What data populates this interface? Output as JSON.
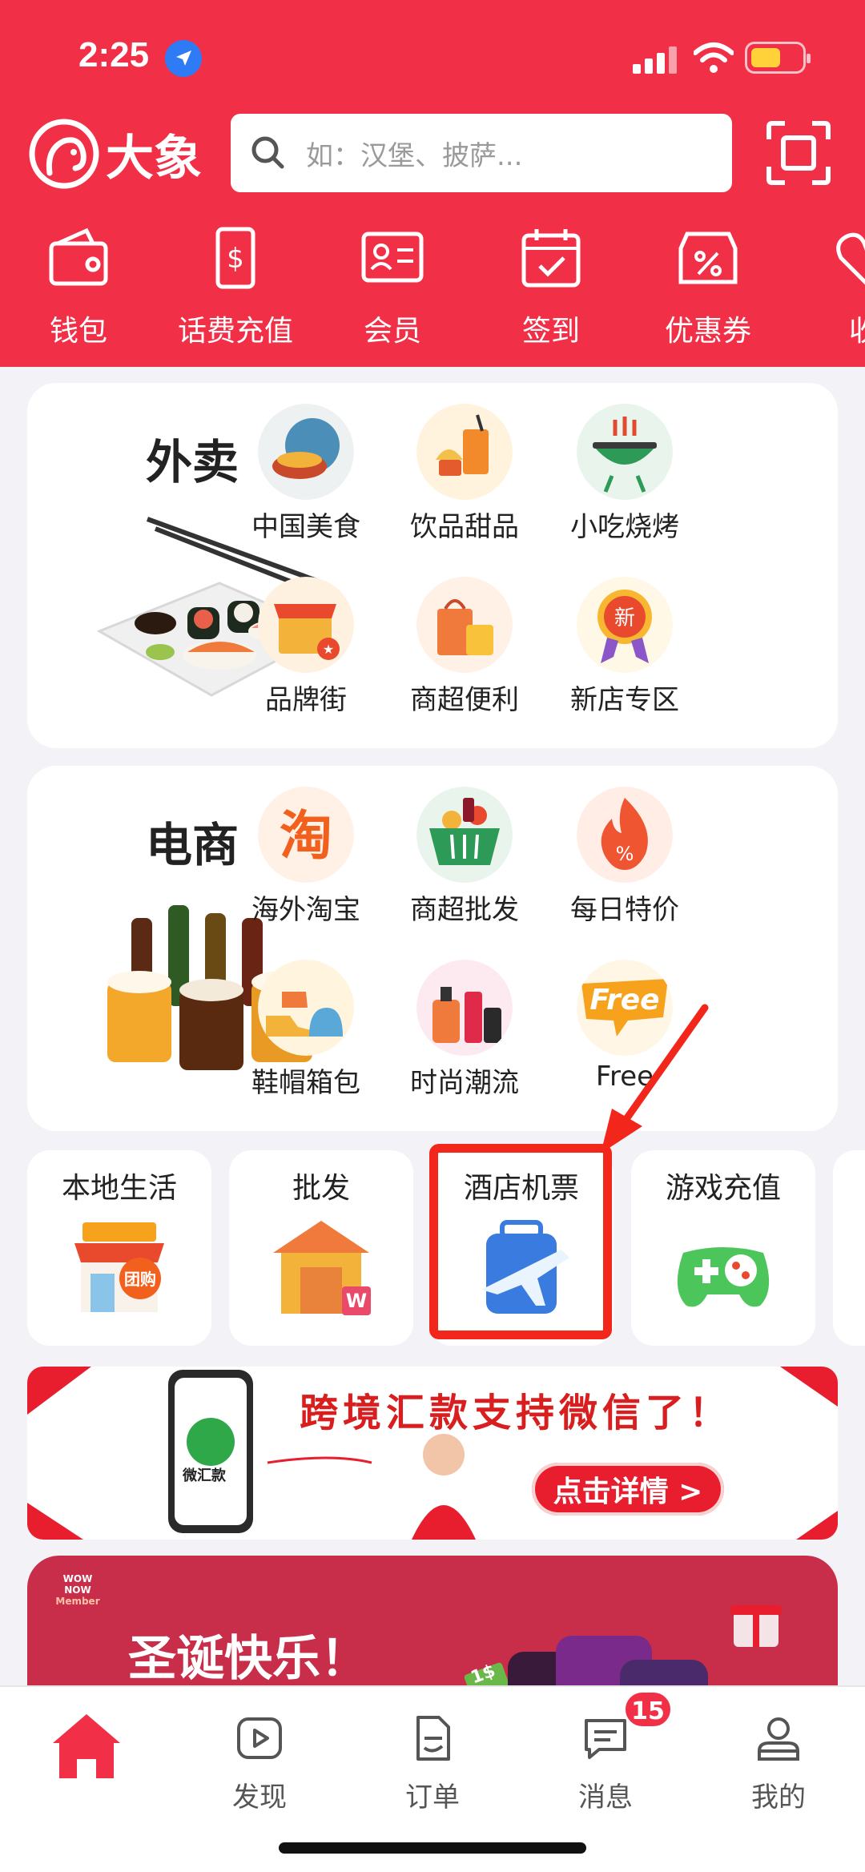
{
  "status_bar": {
    "time": "2:25"
  },
  "header": {
    "brand_name": "大象",
    "search_placeholder": "如：汉堡、披萨...",
    "scan_icon": "scan-icon"
  },
  "quick_actions": [
    {
      "label": "钱包",
      "icon": "wallet-icon"
    },
    {
      "label": "话费充值",
      "icon": "phone-recharge-icon"
    },
    {
      "label": "会员",
      "icon": "member-card-icon"
    },
    {
      "label": "签到",
      "icon": "calendar-check-icon"
    },
    {
      "label": "优惠券",
      "icon": "coupon-icon"
    },
    {
      "label": "收",
      "icon": "favorite-icon"
    }
  ],
  "takeaway": {
    "title": "外卖",
    "categories": [
      {
        "label": "中国美食",
        "icon": "chinese-food-icon"
      },
      {
        "label": "饮品甜品",
        "icon": "drinks-dessert-icon"
      },
      {
        "label": "小吃烧烤",
        "icon": "bbq-icon"
      },
      {
        "label": "品牌街",
        "icon": "brand-street-icon"
      },
      {
        "label": "商超便利",
        "icon": "supermarket-icon"
      },
      {
        "label": "新店专区",
        "icon": "new-store-icon"
      }
    ]
  },
  "ecommerce": {
    "title": "电商",
    "categories": [
      {
        "label": "海外淘宝",
        "icon": "taobao-icon"
      },
      {
        "label": "商超批发",
        "icon": "wholesale-basket-icon"
      },
      {
        "label": "每日特价",
        "icon": "daily-deal-icon"
      },
      {
        "label": "鞋帽箱包",
        "icon": "shoes-hats-icon"
      },
      {
        "label": "时尚潮流",
        "icon": "fashion-icon"
      },
      {
        "label": "Free",
        "icon": "free-icon"
      }
    ]
  },
  "service_tiles": [
    {
      "label": "本地生活",
      "icon": "local-life-icon"
    },
    {
      "label": "批发",
      "icon": "wholesale-store-icon"
    },
    {
      "label": "酒店机票",
      "icon": "hotel-flight-icon"
    },
    {
      "label": "游戏充值",
      "icon": "game-controller-icon"
    }
  ],
  "banner_remittance": {
    "headline": "跨境汇款支持微信了！",
    "phone_label": "微汇款",
    "cta": "点击详情 >"
  },
  "banner_christmas": {
    "tag_line1": "WOW",
    "tag_line2": "NOW",
    "tag_line3": "Member",
    "headline": "圣诞快乐！",
    "money_tag": "1$"
  },
  "bottom_nav": [
    {
      "label": "",
      "icon": "home-icon"
    },
    {
      "label": "发现",
      "icon": "discover-play-icon"
    },
    {
      "label": "订单",
      "icon": "order-document-icon"
    },
    {
      "label": "消息",
      "icon": "message-icon"
    },
    {
      "label": "我的",
      "icon": "profile-icon"
    }
  ],
  "message_badge": "15",
  "colors": {
    "brand_red": "#F12F46",
    "highlight_red": "#F2261A",
    "background": "#F3F3F7"
  }
}
